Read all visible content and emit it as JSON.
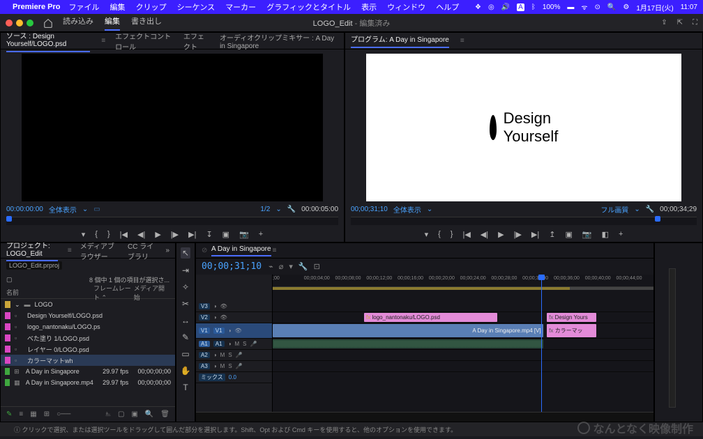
{
  "menubar": {
    "app_name": "Premiere Pro",
    "items": [
      "ファイル",
      "編集",
      "クリップ",
      "シーケンス",
      "マーカー",
      "グラフィックとタイトル",
      "表示",
      "ウィンドウ",
      "ヘルプ"
    ],
    "right": {
      "battery": "100%",
      "battery_icon": "🔋",
      "wifi": "ᯤ",
      "date": "1月17日(火)",
      "time": "11:07"
    }
  },
  "toolbar": {
    "workspaces": [
      "読み込み",
      "編集",
      "書き出し"
    ],
    "workspace_active_index": 1,
    "title": "LOGO_Edit",
    "title_suffix": "- 編集済み"
  },
  "source": {
    "tabs": [
      "ソース : Design Yourself/LOGO.psd",
      "エフェクトコントロール",
      "エフェクト",
      "オーディオクリップミキサー : A Day in Singapore"
    ],
    "active_tab_index": 0,
    "tc_left": "00:00:00:00",
    "fit_label": "全体表示",
    "half_label": "1/2",
    "tc_right": "00:00:05:00"
  },
  "program": {
    "tab": "プログラム: A Day in Singapore",
    "logo_text_line1": "Design",
    "logo_text_line2": "Yourself",
    "tc_left": "00;00;31;10",
    "fit_label": "全体表示",
    "quality_label": "フル画質",
    "tc_right": "00;00;34;29"
  },
  "project": {
    "tabs": [
      "プロジェクト: LOGO_Edit",
      "メディアブラウザー",
      "CC ライブラリ"
    ],
    "active_tab_index": 0,
    "file": "LOGO_Edit.prproj",
    "count_label": "8 個中 1 個の項目が選択さ...",
    "col_name": "名前",
    "col_fps": "フレームレート ⌃",
    "col_media": "メディア開始",
    "bin_name": "LOGO",
    "items": [
      {
        "swatch": "#d946c2",
        "name": "Design Yourself/LOGO.psd"
      },
      {
        "swatch": "#d946c2",
        "name": "logo_nantonaku/LOGO.ps"
      },
      {
        "swatch": "#d946c2",
        "name": "べた塗り 1/LOGO.psd"
      },
      {
        "swatch": "#d946c2",
        "name": "レイヤー 0/LOGO.psd"
      },
      {
        "swatch": "#d946c2",
        "name": "カラーマットwh",
        "selected": true
      },
      {
        "swatch": "#3fa83f",
        "name": "A Day in Singapore",
        "fps": "29.97 fps",
        "start": "00;00;00;00",
        "icon": "seq"
      },
      {
        "swatch": "#3fa83f",
        "name": "A Day in Singapore.mp4",
        "fps": "29.97 fps",
        "start": "00;00;00;00",
        "icon": "vid"
      }
    ]
  },
  "timeline": {
    "tab": "A Day in Singapore",
    "tc": "00;00;31;10",
    "ruler": [
      ";00",
      "00;00;04;00",
      "00;00;08;00",
      "00;00;12;00",
      "00;00;16;00",
      "00;00;20;00",
      "00;00;24;00",
      "00;00;28;00",
      "00;00;32;00",
      "00;00;36;00",
      "00;00;40;00",
      "00;00;44;00"
    ],
    "tracks_v": [
      "V3",
      "V2",
      "V1"
    ],
    "tracks_a": [
      "A1",
      "A2",
      "A3"
    ],
    "mix_label": "ミックス",
    "mix_val": "0.0",
    "clips": {
      "v2_pink": "logo_nantonaku/LOGO.psd",
      "v1_blue": "A Day in Singapore.mp4 [V]",
      "v2_pink2": "Design Yours",
      "v1_pink": "カラーマッ"
    }
  },
  "status": {
    "text": "クリックで選択、または選択ツールをドラッグして囲んだ部分を選択します。Shift、Opt および Cmd キーを使用すると、他のオプションを使用できます。"
  },
  "watermark": "なんとなく映像制作"
}
